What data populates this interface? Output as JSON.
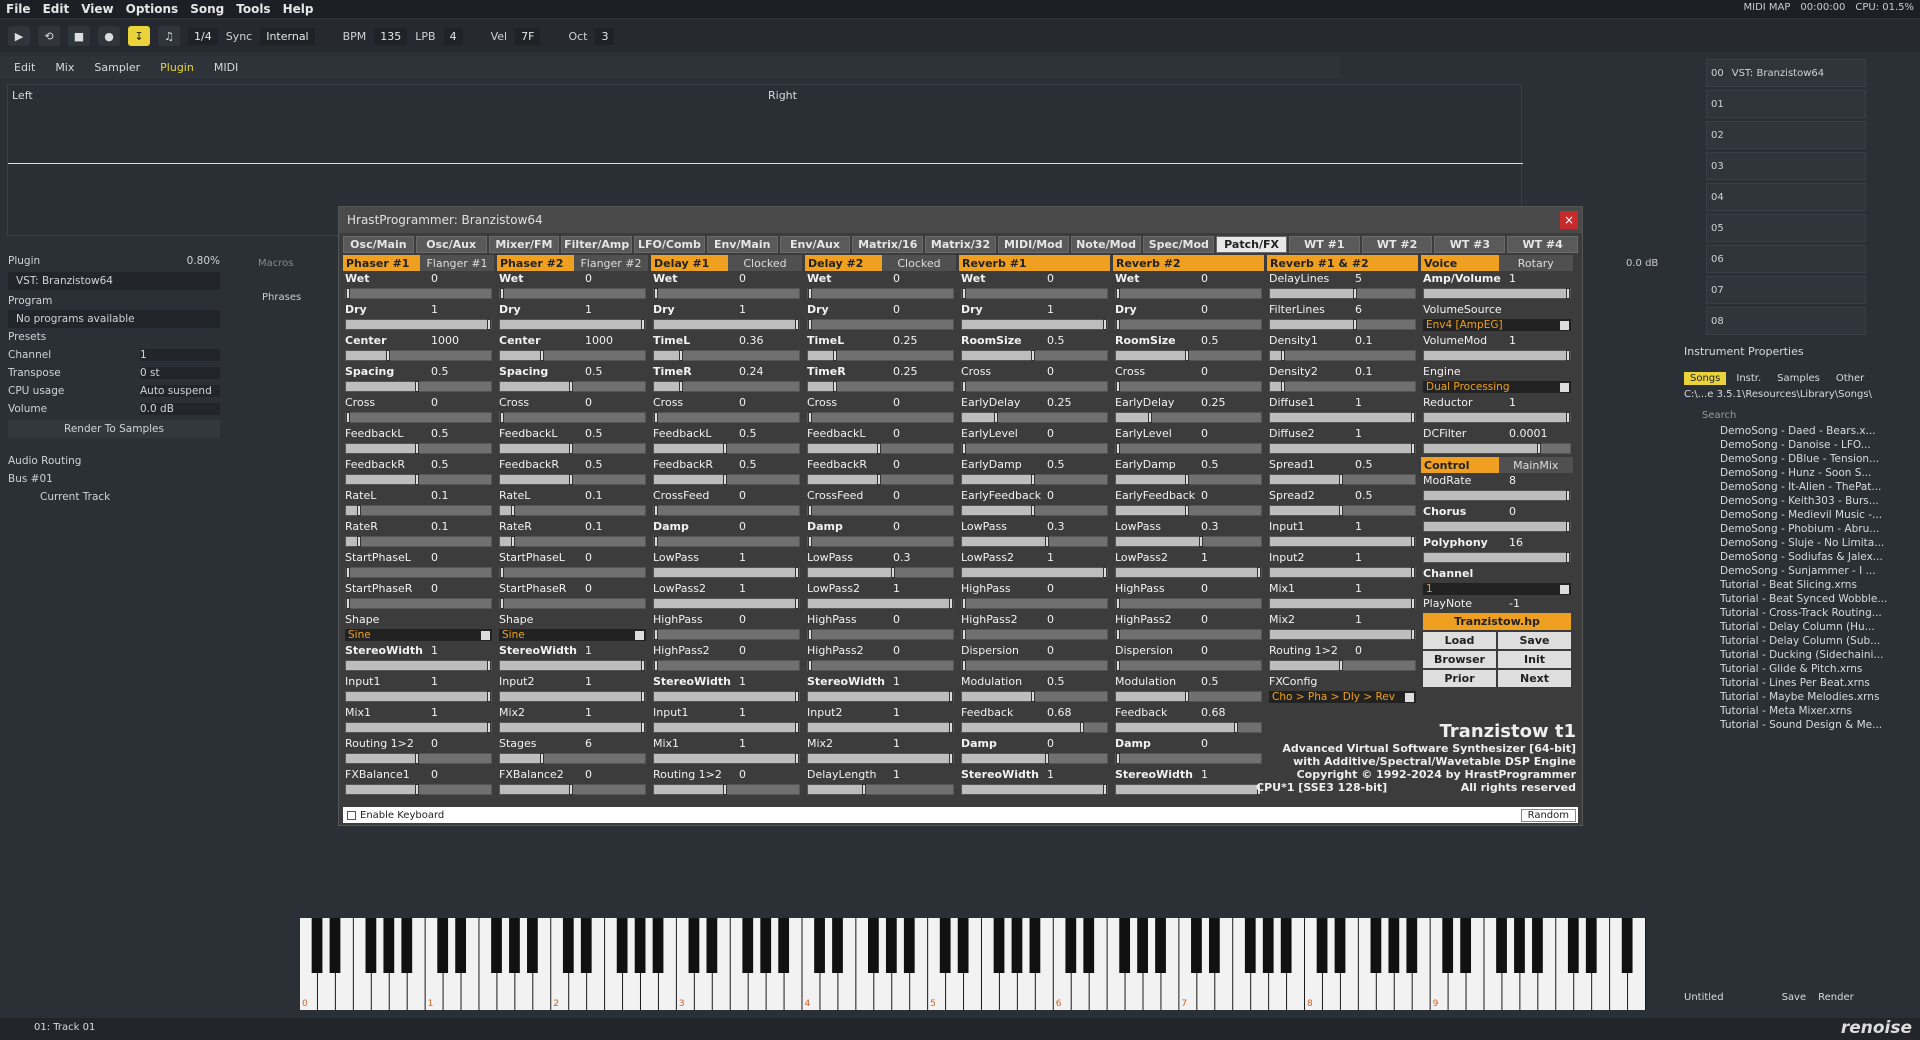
{
  "menu": [
    "File",
    "Edit",
    "View",
    "Options",
    "Song",
    "Tools",
    "Help"
  ],
  "topright": {
    "midimap": "MIDI MAP",
    "time": "00:00:00",
    "cpu": "CPU: 01.5%"
  },
  "toolbar": {
    "pattern": "1/4",
    "sync_label": "Sync",
    "sync": "Internal",
    "bpm_label": "BPM",
    "bpm": "135",
    "lpb_label": "LPB",
    "lpb": "4",
    "vel_label": "Vel",
    "vel": "7F",
    "oct_label": "Oct",
    "oct": "3"
  },
  "tabs": [
    "Edit",
    "Mix",
    "Sampler",
    "Plugin",
    "MIDI"
  ],
  "scope": {
    "left": "Left",
    "right": "Right"
  },
  "leftpanel": {
    "plugin": "Plugin",
    "cpu": "0.80%",
    "vst": "VST: Branzistow64",
    "program": "Program",
    "noprog": "No programs available",
    "presets": "Presets",
    "channel_label": "Channel",
    "channel": "1",
    "transpose_label": "Transpose",
    "transpose": "0 st",
    "cpuusage_label": "CPU usage",
    "cpuusage": "Auto suspend",
    "volume_label": "Volume",
    "volume": "0.0 dB",
    "render": "Render To Samples",
    "routing": "Audio Routing",
    "bus": "Bus #01",
    "track": "Current Track",
    "macros": "Macros",
    "phrases": "Phrases",
    "db": "0.0 dB"
  },
  "plugin": {
    "title": "HrastProgrammer: Branzistow64",
    "tabs": [
      "Osc/Main",
      "Osc/Aux",
      "Mixer/FM",
      "Filter/Amp",
      "LFO/Comb",
      "Env/Main",
      "Env/Aux",
      "Matrix/16",
      "Matrix/32",
      "MIDI/Mod",
      "Note/Mod",
      "Spec/Mod",
      "Patch/FX",
      "WT #1",
      "WT #2",
      "WT #3",
      "WT #4"
    ],
    "active_tab": "Patch/FX",
    "columns": [
      {
        "h1": "Phaser #1",
        "h2": "Flanger #1",
        "params": [
          [
            "Wet",
            "0",
            0,
            1
          ],
          [
            "Dry",
            "1",
            1,
            1
          ],
          [
            "Center",
            "1000",
            0.3,
            1
          ],
          [
            "Spacing",
            "0.5",
            0.5,
            1
          ],
          [
            "Cross",
            "0",
            0,
            0
          ],
          [
            "FeedbackL",
            "0.5",
            0.5,
            0
          ],
          [
            "FeedbackR",
            "0.5",
            0.5,
            0
          ],
          [
            "RateL",
            "0.1",
            0.1,
            0
          ],
          [
            "RateR",
            "0.1",
            0.1,
            0
          ],
          [
            "StartPhaseL",
            "0",
            0,
            0
          ],
          [
            "StartPhaseR",
            "0",
            0,
            0
          ],
          [
            "Shape",
            "",
            -1,
            0
          ],
          [
            "StereoWidth",
            "1",
            1,
            1
          ],
          [
            "Input1",
            "1",
            1,
            0
          ],
          [
            "Mix1",
            "1",
            1,
            0
          ],
          [
            "Routing 1>2",
            "0",
            0.5,
            0
          ],
          [
            "FXBalance1",
            "0",
            0.5,
            0
          ]
        ],
        "shape": "Sine"
      },
      {
        "h1": "Phaser #2",
        "h2": "Flanger #2",
        "params": [
          [
            "Wet",
            "0",
            0,
            1
          ],
          [
            "Dry",
            "1",
            1,
            1
          ],
          [
            "Center",
            "1000",
            0.3,
            1
          ],
          [
            "Spacing",
            "0.5",
            0.5,
            1
          ],
          [
            "Cross",
            "0",
            0,
            0
          ],
          [
            "FeedbackL",
            "0.5",
            0.5,
            0
          ],
          [
            "FeedbackR",
            "0.5",
            0.5,
            0
          ],
          [
            "RateL",
            "0.1",
            0.1,
            0
          ],
          [
            "RateR",
            "0.1",
            0.1,
            0
          ],
          [
            "StartPhaseL",
            "0",
            0,
            0
          ],
          [
            "StartPhaseR",
            "0",
            0,
            0
          ],
          [
            "Shape",
            "",
            -1,
            0
          ],
          [
            "StereoWidth",
            "1",
            1,
            1
          ],
          [
            "Input2",
            "1",
            1,
            0
          ],
          [
            "Mix2",
            "1",
            1,
            0
          ],
          [
            "Stages",
            "6",
            0.3,
            0
          ],
          [
            "FXBalance2",
            "0",
            0.5,
            0
          ]
        ],
        "shape": "Sine"
      },
      {
        "h1": "Delay #1",
        "h2": "Clocked",
        "params": [
          [
            "Wet",
            "0",
            0,
            1
          ],
          [
            "Dry",
            "1",
            1,
            1
          ],
          [
            "TimeL",
            "0.36",
            0.2,
            1
          ],
          [
            "TimeR",
            "0.24",
            0.2,
            1
          ],
          [
            "Cross",
            "0",
            0,
            0
          ],
          [
            "FeedbackL",
            "0.5",
            0.5,
            0
          ],
          [
            "FeedbackR",
            "0.5",
            0.5,
            0
          ],
          [
            "CrossFeed",
            "0",
            0,
            0
          ],
          [
            "Damp",
            "0",
            0,
            1
          ],
          [
            "LowPass",
            "1",
            1,
            0
          ],
          [
            "LowPass2",
            "1",
            1,
            0
          ],
          [
            "HighPass",
            "0",
            0,
            0
          ],
          [
            "HighPass2",
            "0",
            0,
            0
          ],
          [
            "StereoWidth",
            "1",
            1,
            1
          ],
          [
            "Input1",
            "1",
            1,
            0
          ],
          [
            "Mix1",
            "1",
            1,
            0
          ],
          [
            "Routing 1>2",
            "0",
            0.5,
            0
          ]
        ]
      },
      {
        "h1": "Delay #2",
        "h2": "Clocked",
        "params": [
          [
            "Wet",
            "0",
            0,
            1
          ],
          [
            "Dry",
            "0",
            0,
            1
          ],
          [
            "TimeL",
            "0.25",
            0.2,
            1
          ],
          [
            "TimeR",
            "0.25",
            0.2,
            1
          ],
          [
            "Cross",
            "0",
            0,
            0
          ],
          [
            "FeedbackL",
            "0",
            0.5,
            0
          ],
          [
            "FeedbackR",
            "0",
            0.5,
            0
          ],
          [
            "CrossFeed",
            "0",
            0,
            0
          ],
          [
            "Damp",
            "0",
            0,
            1
          ],
          [
            "LowPass",
            "0.3",
            0.6,
            0
          ],
          [
            "LowPass2",
            "1",
            1,
            0
          ],
          [
            "HighPass",
            "0",
            0,
            0
          ],
          [
            "HighPass2",
            "0",
            0,
            0
          ],
          [
            "StereoWidth",
            "1",
            1,
            1
          ],
          [
            "Input2",
            "1",
            1,
            0
          ],
          [
            "Mix2",
            "1",
            1,
            0
          ],
          [
            "DelayLength",
            "1",
            0.4,
            0
          ]
        ]
      },
      {
        "h1": "Reverb #1",
        "h2": "",
        "params": [
          [
            "Wet",
            "0",
            0,
            1
          ],
          [
            "Dry",
            "1",
            1,
            1
          ],
          [
            "RoomSize",
            "0.5",
            0.5,
            1
          ],
          [
            "Cross",
            "0",
            0,
            0
          ],
          [
            "EarlyDelay",
            "0.25",
            0.25,
            0
          ],
          [
            "EarlyLevel",
            "0",
            0,
            0
          ],
          [
            "EarlyDamp",
            "0.5",
            0.5,
            0
          ],
          [
            "EarlyFeedback",
            "0",
            0.5,
            0
          ],
          [
            "LowPass",
            "0.3",
            0.6,
            0
          ],
          [
            "LowPass2",
            "1",
            1,
            0
          ],
          [
            "HighPass",
            "0",
            0,
            0
          ],
          [
            "HighPass2",
            "0",
            0,
            0
          ],
          [
            "Dispersion",
            "0",
            0,
            0
          ],
          [
            "Modulation",
            "0.5",
            0.5,
            0
          ],
          [
            "Feedback",
            "0.68",
            0.84,
            0
          ],
          [
            "Damp",
            "0",
            0.6,
            1
          ],
          [
            "StereoWidth",
            "1",
            1,
            1
          ]
        ]
      },
      {
        "h1": "Reverb #2",
        "h2": "",
        "params": [
          [
            "Wet",
            "0",
            0,
            1
          ],
          [
            "Dry",
            "0",
            0,
            1
          ],
          [
            "RoomSize",
            "0.5",
            0.5,
            1
          ],
          [
            "Cross",
            "0",
            0,
            0
          ],
          [
            "EarlyDelay",
            "0.25",
            0.25,
            0
          ],
          [
            "EarlyLevel",
            "0",
            0,
            0
          ],
          [
            "EarlyDamp",
            "0.5",
            0.5,
            0
          ],
          [
            "EarlyFeedback",
            "0",
            0.5,
            0
          ],
          [
            "LowPass",
            "0.3",
            0.6,
            0
          ],
          [
            "LowPass2",
            "1",
            1,
            0
          ],
          [
            "HighPass",
            "0",
            0,
            0
          ],
          [
            "HighPass2",
            "0",
            0,
            0
          ],
          [
            "Dispersion",
            "0",
            0,
            0
          ],
          [
            "Modulation",
            "0.5",
            0.5,
            0
          ],
          [
            "Feedback",
            "0.68",
            0.84,
            0
          ],
          [
            "Damp",
            "0",
            0,
            1
          ],
          [
            "StereoWidth",
            "1",
            1,
            1
          ]
        ]
      },
      {
        "h1": "Reverb #1 & #2",
        "h2": "",
        "params": [
          [
            "DelayLines",
            "5",
            0.6,
            0
          ],
          [
            "FilterLines",
            "6",
            0.6,
            0
          ],
          [
            "Density1",
            "0.1",
            0.1,
            0
          ],
          [
            "Density2",
            "0.1",
            0.1,
            0
          ],
          [
            "Diffuse1",
            "1",
            1,
            0
          ],
          [
            "Diffuse2",
            "1",
            1,
            0
          ],
          [
            "Spread1",
            "0.5",
            0.5,
            0
          ],
          [
            "Spread2",
            "0.5",
            0.5,
            0
          ],
          [
            "Input1",
            "1",
            1,
            0
          ],
          [
            "Input2",
            "1",
            1,
            0
          ],
          [
            "Mix1",
            "1",
            1,
            0
          ],
          [
            "Mix2",
            "1",
            1,
            0
          ],
          [
            "Routing 1>2",
            "0",
            0.5,
            0
          ]
        ],
        "fxconfig_label": "FXConfig",
        "fxconfig": "Cho > Pha > Dly > Rev"
      }
    ],
    "voice": {
      "h1": "Voice",
      "h2": "Rotary",
      "amp_label": "Amp/Volume",
      "amp": "1",
      "volsrc_label": "VolumeSource",
      "volsrc": "Env4 [AmpEG]",
      "volmod_label": "VolumeMod",
      "volmod": "1",
      "engine_label": "Engine",
      "engine": "Dual Processing",
      "reductor_label": "Reductor",
      "reductor": "1",
      "dcfilter_label": "DCFilter",
      "dcfilter": "0.0001",
      "control": "Control",
      "mainmix": "MainMix",
      "modrate_label": "ModRate",
      "modrate": "8",
      "chorus_label": "Chorus",
      "chorus": "0",
      "poly_label": "Polyphony",
      "poly": "16",
      "channel_label": "Channel",
      "channel": "1",
      "playnote_label": "PlayNote",
      "playnote": "-1",
      "patchfile": "Tranzistow.hp",
      "load": "Load",
      "save": "Save",
      "browser": "Browser",
      "init": "Init",
      "prior": "Prior",
      "next": "Next"
    },
    "info": {
      "name": "Tranzistow t1",
      "l1": "Advanced Virtual Software Synthesizer [64-bit]",
      "l2": "with Additive/Spectral/Wavetable DSP Engine",
      "l3": "Copyright © 1992-2024 by HrastProgrammer",
      "cpu": "CPU*1 [SSE3 128-bit]",
      "rights": "All rights reserved"
    },
    "enable_kb": "Enable Keyboard",
    "random": "Random"
  },
  "right": {
    "vst": "VST: Branzistow64",
    "slots": [
      "00",
      "01",
      "02",
      "03",
      "04",
      "05",
      "06",
      "07",
      "08"
    ],
    "instprops": "Instrument Properties",
    "tabs": [
      "Songs",
      "Instr.",
      "Samples",
      "Other"
    ],
    "path": "C:\\...e 3.5.1\\Resources\\Library\\Songs\\",
    "search": "Search",
    "songs": [
      "DemoSong - Daed - Bears.x...",
      "DemoSong - Danoise - LFO...",
      "DemoSong - DBlue - Tension...",
      "DemoSong - Hunz - Soon S...",
      "DemoSong - It-Alien - ThePat...",
      "DemoSong - Keith303 - Burs...",
      "DemoSong - Medievil Music -...",
      "DemoSong - Phobium - Abru...",
      "DemoSong - Sluje - No Limita...",
      "DemoSong - Sodiufas & Jalex...",
      "DemoSong - Sunjammer - I ...",
      "Tutorial - Beat Slicing.xrns",
      "Tutorial - Beat Synced Wobble...",
      "Tutorial - Cross-Track Routing...",
      "Tutorial - Delay Column (Hu...",
      "Tutorial - Delay Column (Sub...",
      "Tutorial - Ducking (Sidechaini...",
      "Tutorial - Glide & Pitch.xrns",
      "Tutorial - Lines Per Beat.xrns",
      "Tutorial - Maybe Melodies.xrns",
      "Tutorial - Meta Mixer.xrns",
      "Tutorial - Sound Design & Me..."
    ],
    "untitled": "Untitled",
    "save": "Save",
    "render": "Render"
  },
  "keyboard": {
    "octaves": [
      "0",
      "1",
      "2",
      "3",
      "4",
      "5",
      "6",
      "7",
      "8",
      "9"
    ]
  },
  "status": {
    "track": "01: Track 01",
    "logo": "renoise"
  }
}
